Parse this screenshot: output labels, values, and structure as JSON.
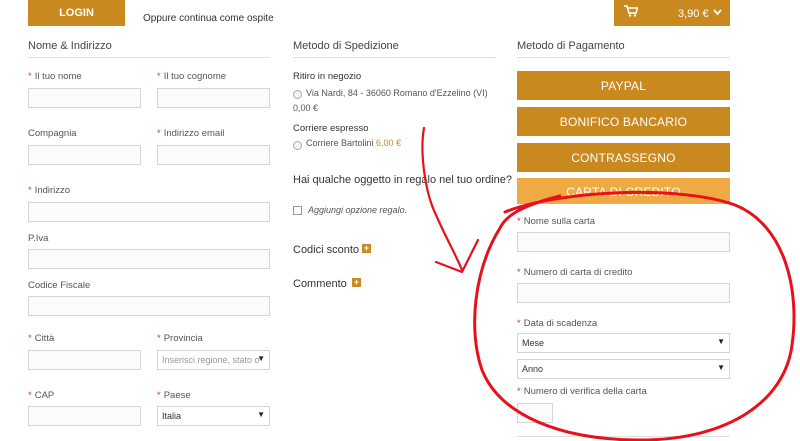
{
  "header": {
    "login_label": "LOGIN",
    "guest_text": "Oppure continua come ospite",
    "cart_total": "3,90 €"
  },
  "address": {
    "title": "Nome & Indirizzo",
    "first_name": "Il tuo nome",
    "last_name": "Il tuo cognome",
    "company": "Compagnia",
    "email": "Indirizzo email",
    "address": "Indirizzo",
    "vat": "P.Iva",
    "tax_code": "Codice Fiscale",
    "city": "Città",
    "province": "Provincia",
    "province_placeholder": "Inserisci regione, stato o",
    "zip": "CAP",
    "country": "Paese",
    "country_value": "Italia"
  },
  "shipping": {
    "title": "Metodo di Spedizione",
    "pickup_title": "Ritiro in negozio",
    "pickup_option": "Via Nardi, 84 - 36060 Romano d'Ezzelino (VI)",
    "pickup_price": "0,00 €",
    "express_title": "Corriere espresso",
    "express_option": "Corriere Bartolini",
    "express_price": "6,00 €",
    "gift_question": "Hai qualche oggetto in regalo nel tuo ordine?",
    "gift_option": "Aggiungi opzione regalo.",
    "discount": "Codici sconto",
    "comment": "Commento"
  },
  "payment": {
    "title": "Metodo di Pagamento",
    "methods": [
      "PAYPAL",
      "BONIFICO BANCARIO",
      "CONTRASSEGNO",
      "CARTA DI CREDITO"
    ],
    "card_name": "Nome sulla carta",
    "card_number": "Numero di carta di credito",
    "expiry": "Data di scadenza",
    "month": "Mese",
    "year": "Anno",
    "cvv": "Numero di verifica della carta"
  },
  "colors": {
    "accent": "#c9891f",
    "active": "#efaa43",
    "annotation": "#e8101a"
  }
}
